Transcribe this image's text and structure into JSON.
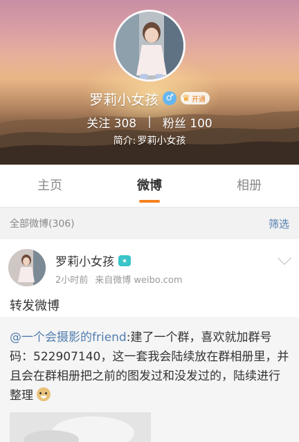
{
  "profile": {
    "name": "罗莉小女孩",
    "gender_icon": "♂",
    "vip_label": "开通",
    "stats": {
      "following_label": "关注",
      "following_count": "308",
      "separator": "|",
      "followers_label": "粉丝",
      "followers_count": "100"
    },
    "bio_label": "简介:",
    "bio_text": "罗莉小女孩"
  },
  "tabs": [
    {
      "label": "主页",
      "active": false
    },
    {
      "label": "微博",
      "active": true
    },
    {
      "label": "相册",
      "active": false
    }
  ],
  "filter_bar": {
    "label": "全部微博(306)",
    "button": "筛选"
  },
  "post": {
    "author": "罗莉小女孩",
    "time": "2小时前",
    "source": "来自微博 weibo.com",
    "text": "转发微博"
  },
  "repost": {
    "mention": "@一个会摄影的friend",
    "body": ":建了一个群，喜欢就加群号码：522907140，这一套我会陆续放在群相册里，并且会在群相册把之前的图发过和没发过的，陆续进行整理"
  },
  "colors": {
    "accent_orange": "#f5821f",
    "link_blue": "#507daf",
    "gender_blue": "#66b6f0",
    "camera_teal": "#39c4c8"
  },
  "icons": [
    "male-gender-icon",
    "crown-icon",
    "camera-icon",
    "chevron-down-icon",
    "doge-emoji-icon"
  ]
}
